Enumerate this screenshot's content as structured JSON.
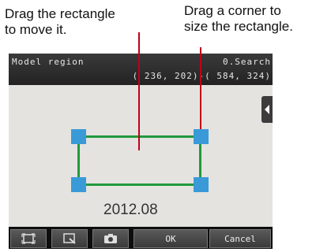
{
  "callouts": {
    "move": "Drag the rectangle\nto move it.",
    "size": "Drag a corner to\nsize the rectangle."
  },
  "screen": {
    "title": "Model region",
    "search_mode": "0.Search",
    "coords": "( 236, 202)-( 584, 324)",
    "measured_value": "2012.08"
  },
  "toolbar": {
    "buttons": [
      {
        "icon": "fit-frame-icon"
      },
      {
        "icon": "zoom-icon"
      },
      {
        "icon": "camera-icon"
      },
      {
        "label": "OK"
      },
      {
        "label": "Cancel"
      }
    ]
  },
  "colors": {
    "rectangle": "#1f9a3c",
    "handles": "#3a9ad8",
    "leader_lines": "#c0001a"
  }
}
